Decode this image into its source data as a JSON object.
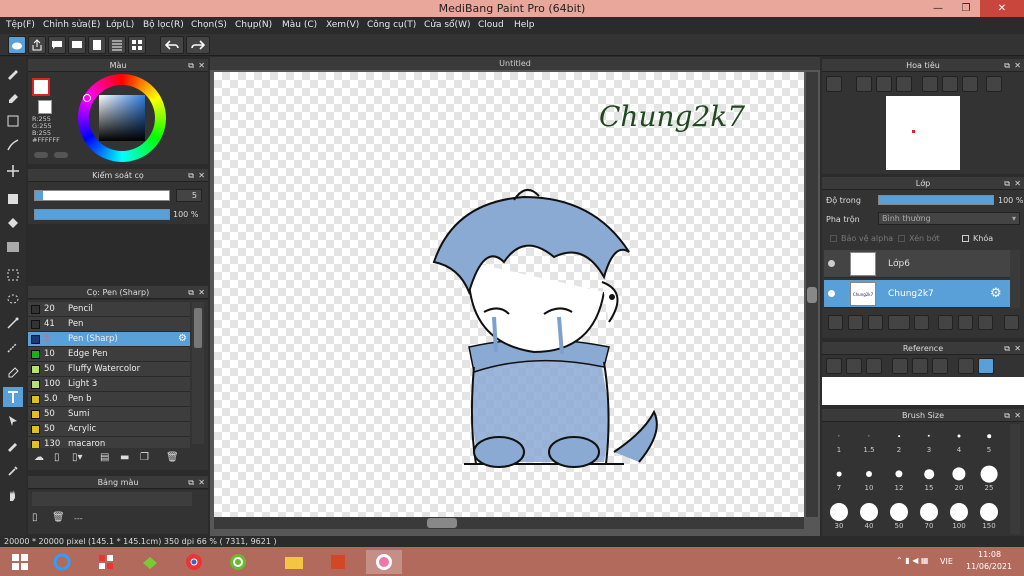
{
  "window": {
    "title": "MediBang Paint Pro (64bit)"
  },
  "menu": [
    "Tệp(F)",
    "Chỉnh sửa(E)",
    "Lớp(L)",
    "Bộ lọc(R)",
    "Chọn(S)",
    "Chụp(N)",
    "Màu (C)",
    "Xem(V)",
    "Công cụ(T)",
    "Cửa sổ(W)",
    "Cloud",
    "Help"
  ],
  "color_panel": {
    "title": "Màu",
    "rgb": "R:255\nG:255\nB:255",
    "hex": "#FFFFFF",
    "accent": "#5aa0d8"
  },
  "brush_control": {
    "title": "Kiểm soát cọ",
    "size": "5",
    "opacity": "100 %"
  },
  "brush_panel": {
    "title": "Cọ: Pen (Sharp)",
    "items": [
      {
        "size": "20",
        "name": "Pencil",
        "color": "#333333"
      },
      {
        "size": "41",
        "name": "Pen",
        "color": "#333333"
      },
      {
        "size": "5",
        "name": "Pen (Sharp)",
        "color": "#1a3a6a"
      },
      {
        "size": "10",
        "name": "Edge Pen",
        "color": "#22aa22"
      },
      {
        "size": "50",
        "name": "Fluffy Watercolor",
        "color": "#b8e070"
      },
      {
        "size": "100",
        "name": "Light 3",
        "color": "#b8e070"
      },
      {
        "size": "5.0",
        "name": " Pen b",
        "color": "#e0c020"
      },
      {
        "size": "50",
        "name": "Sumi",
        "color": "#e0c020"
      },
      {
        "size": "50",
        "name": "Acrylic",
        "color": "#e0c020"
      },
      {
        "size": "130",
        "name": "macaron",
        "color": "#e0c020"
      }
    ]
  },
  "palette_panel": {
    "title": "Bảng màu",
    "value": "---"
  },
  "canvas": {
    "tab": "Untitled",
    "signature": "Chung2k7"
  },
  "navigator": {
    "title": "Hoa tiêu"
  },
  "layers": {
    "title": "Lớp",
    "opacity_label": "Độ trong",
    "opacity_value": "100 %",
    "blend_label": "Pha trộn",
    "blend_value": "Bình thường",
    "protect_alpha": "Bảo vệ alpha",
    "clipping": "Xén bớt",
    "lock": "Khóa",
    "items": [
      {
        "name": "Lớp6",
        "thumb": "",
        "selected": false
      },
      {
        "name": "Chung2k7",
        "thumb": "Chung2k7",
        "selected": true
      }
    ]
  },
  "reference": {
    "title": "Reference"
  },
  "brush_size": {
    "title": "Brush Size",
    "sizes": [
      "1",
      "1.5",
      "2",
      "3",
      "4",
      "5",
      "7",
      "10",
      "12",
      "15",
      "20",
      "25",
      "30",
      "40",
      "50",
      "70",
      "100",
      "150"
    ],
    "dots": [
      1,
      1,
      1.5,
      2,
      2.5,
      3,
      4,
      5,
      6,
      8,
      11,
      14,
      15,
      15,
      15,
      15,
      15,
      15
    ]
  },
  "status": {
    "text": "20000 * 20000 pixel   (145.1 * 145.1cm)   350 dpi   66 %   ( 7311, 9621 )"
  },
  "taskbar": {
    "lang": "VIE",
    "time": "11:08",
    "date": "11/06/2021"
  }
}
